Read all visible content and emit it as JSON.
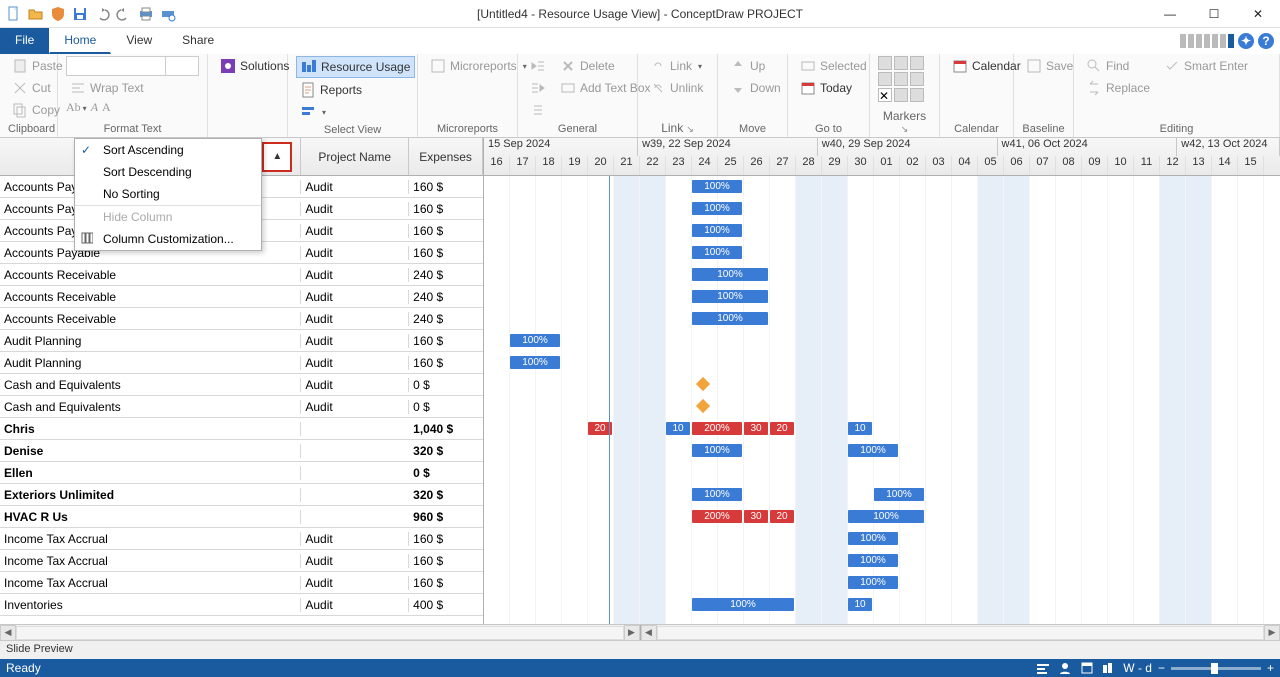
{
  "window": {
    "title": "[Untitled4 - Resource Usage View] - ConceptDraw PROJECT"
  },
  "tabs": {
    "file": "File",
    "home": "Home",
    "view": "View",
    "share": "Share"
  },
  "ribbon": {
    "clipboard": {
      "paste": "Paste",
      "cut": "Cut",
      "copy": "Copy",
      "title": "Clipboard"
    },
    "format": {
      "wrap": "Wrap Text",
      "title": "Format Text"
    },
    "solutions": "Solutions",
    "selectview": {
      "resource_usage": "Resource Usage",
      "reports": "Reports",
      "title": "Select View"
    },
    "microreports": {
      "btn": "Microreports",
      "title": "Microreports"
    },
    "general": {
      "delete": "Delete",
      "addtext": "Add Text Box",
      "title": "General"
    },
    "link_group": {
      "link": "Link",
      "unlink": "Unlink",
      "title": "Link"
    },
    "move": {
      "up": "Up",
      "down": "Down",
      "title": "Move"
    },
    "goto": {
      "selected": "Selected",
      "today": "Today",
      "title": "Go to"
    },
    "markers": {
      "title": "Markers"
    },
    "calendar": {
      "btn": "Calendar",
      "title": "Calendar"
    },
    "baseline": {
      "save": "Save",
      "title": "Baseline"
    },
    "editing": {
      "find": "Find",
      "replace": "Replace",
      "smart": "Smart Enter",
      "title": "Editing"
    }
  },
  "grid": {
    "col_project": "Project Name",
    "col_expenses": "Expenses"
  },
  "context_menu": {
    "sort_asc": "Sort Ascending",
    "sort_desc": "Sort Descending",
    "no_sort": "No Sorting",
    "hide_col": "Hide Column",
    "col_custom": "Column Customization..."
  },
  "rows": [
    {
      "name": "Accounts Paya",
      "proj": "Audit",
      "exp": "160 $",
      "summary": false,
      "bars": [
        {
          "start": 8,
          "len": 2,
          "cls": "b100",
          "label": "100%"
        }
      ]
    },
    {
      "name": "Accounts Paya",
      "proj": "Audit",
      "exp": "160 $",
      "summary": false,
      "bars": [
        {
          "start": 8,
          "len": 2,
          "cls": "b100",
          "label": "100%"
        }
      ]
    },
    {
      "name": "Accounts Paya",
      "proj": "Audit",
      "exp": "160 $",
      "summary": false,
      "bars": [
        {
          "start": 8,
          "len": 2,
          "cls": "b100",
          "label": "100%"
        }
      ]
    },
    {
      "name": "Accounts Payable",
      "proj": "Audit",
      "exp": "160 $",
      "summary": false,
      "bars": [
        {
          "start": 8,
          "len": 2,
          "cls": "b100",
          "label": "100%"
        }
      ]
    },
    {
      "name": "Accounts Receivable",
      "proj": "Audit",
      "exp": "240 $",
      "summary": false,
      "bars": [
        {
          "start": 8,
          "len": 3,
          "cls": "b100",
          "label": "100%"
        }
      ]
    },
    {
      "name": "Accounts Receivable",
      "proj": "Audit",
      "exp": "240 $",
      "summary": false,
      "bars": [
        {
          "start": 8,
          "len": 3,
          "cls": "b100",
          "label": "100%"
        }
      ]
    },
    {
      "name": "Accounts Receivable",
      "proj": "Audit",
      "exp": "240 $",
      "summary": false,
      "bars": [
        {
          "start": 8,
          "len": 3,
          "cls": "b100",
          "label": "100%"
        }
      ]
    },
    {
      "name": "Audit Planning",
      "proj": "Audit",
      "exp": "160 $",
      "summary": false,
      "bars": [
        {
          "start": 1,
          "len": 2,
          "cls": "b100",
          "label": "100%"
        }
      ]
    },
    {
      "name": "Audit Planning",
      "proj": "Audit",
      "exp": "160 $",
      "summary": false,
      "bars": [
        {
          "start": 1,
          "len": 2,
          "cls": "b100",
          "label": "100%"
        }
      ]
    },
    {
      "name": "Cash and Equivalents",
      "proj": "Audit",
      "exp": "0 $",
      "summary": false,
      "milestones": [
        {
          "at": 8
        }
      ]
    },
    {
      "name": "Cash and Equivalents",
      "proj": "Audit",
      "exp": "0 $",
      "summary": false,
      "milestones": [
        {
          "at": 8
        }
      ]
    },
    {
      "name": "Chris",
      "proj": "",
      "exp": "1,040 $",
      "summary": true,
      "bars": [
        {
          "start": 4,
          "len": 1,
          "cls": "b200 small",
          "label": "20"
        },
        {
          "start": 7,
          "len": 1,
          "cls": "b100 small",
          "label": "10"
        },
        {
          "start": 8,
          "len": 2,
          "cls": "b200",
          "label": "200%"
        },
        {
          "start": 10,
          "len": 1,
          "cls": "b200 small",
          "label": "30"
        },
        {
          "start": 11,
          "len": 1,
          "cls": "b200 small",
          "label": "20"
        },
        {
          "start": 14,
          "len": 1,
          "cls": "b100 small",
          "label": "10"
        }
      ]
    },
    {
      "name": "Denise",
      "proj": "",
      "exp": "320 $",
      "summary": true,
      "bars": [
        {
          "start": 8,
          "len": 2,
          "cls": "b100",
          "label": "100%"
        },
        {
          "start": 14,
          "len": 2,
          "cls": "b100",
          "label": "100%"
        }
      ]
    },
    {
      "name": "Ellen",
      "proj": "",
      "exp": "0 $",
      "summary": true
    },
    {
      "name": "Exteriors Unlimited",
      "proj": "",
      "exp": "320 $",
      "summary": true,
      "bars": [
        {
          "start": 8,
          "len": 2,
          "cls": "b100",
          "label": "100%"
        },
        {
          "start": 15,
          "len": 2,
          "cls": "b100",
          "label": "100%"
        }
      ]
    },
    {
      "name": "HVAC R Us",
      "proj": "",
      "exp": "960 $",
      "summary": true,
      "bars": [
        {
          "start": 8,
          "len": 2,
          "cls": "b200",
          "label": "200%"
        },
        {
          "start": 10,
          "len": 1,
          "cls": "b200 small",
          "label": "30"
        },
        {
          "start": 11,
          "len": 1,
          "cls": "b200 small",
          "label": "20"
        },
        {
          "start": 14,
          "len": 3,
          "cls": "b100",
          "label": "100%"
        }
      ]
    },
    {
      "name": "Income Tax Accrual",
      "proj": "Audit",
      "exp": "160 $",
      "summary": false,
      "bars": [
        {
          "start": 14,
          "len": 2,
          "cls": "b100",
          "label": "100%"
        }
      ]
    },
    {
      "name": "Income Tax Accrual",
      "proj": "Audit",
      "exp": "160 $",
      "summary": false,
      "bars": [
        {
          "start": 14,
          "len": 2,
          "cls": "b100",
          "label": "100%"
        }
      ]
    },
    {
      "name": "Income Tax Accrual",
      "proj": "Audit",
      "exp": "160 $",
      "summary": false,
      "bars": [
        {
          "start": 14,
          "len": 2,
          "cls": "b100",
          "label": "100%"
        }
      ]
    },
    {
      "name": "Inventories",
      "proj": "Audit",
      "exp": "400 $",
      "summary": false,
      "bars": [
        {
          "start": 8,
          "len": 4,
          "cls": "b100",
          "label": "100%"
        },
        {
          "start": 14,
          "len": 1,
          "cls": "b100 small",
          "label": "10"
        }
      ]
    }
  ],
  "timeline": {
    "weeks": [
      {
        "label": "15 Sep 2024",
        "days": 6,
        "partial_left": true
      },
      {
        "label": "w39, 22 Sep 2024",
        "days": 7
      },
      {
        "label": "w40, 29 Sep 2024",
        "days": 7
      },
      {
        "label": "w41, 06 Oct 2024",
        "days": 7
      },
      {
        "label": "w42, 13 Oct 2024",
        "days": 4,
        "partial_right": true
      }
    ],
    "days": [
      "16",
      "17",
      "18",
      "19",
      "20",
      "21",
      "22",
      "23",
      "24",
      "25",
      "26",
      "27",
      "28",
      "29",
      "30",
      "01",
      "02",
      "03",
      "04",
      "05",
      "06",
      "07",
      "08",
      "09",
      "10",
      "11",
      "12",
      "13",
      "14",
      "15"
    ],
    "weekend_cols": [
      5,
      6,
      12,
      13,
      19,
      20,
      26,
      27
    ],
    "today_col": 4
  },
  "footer": {
    "slide_preview": "Slide Preview",
    "ready": "Ready",
    "scale": "W - d"
  }
}
